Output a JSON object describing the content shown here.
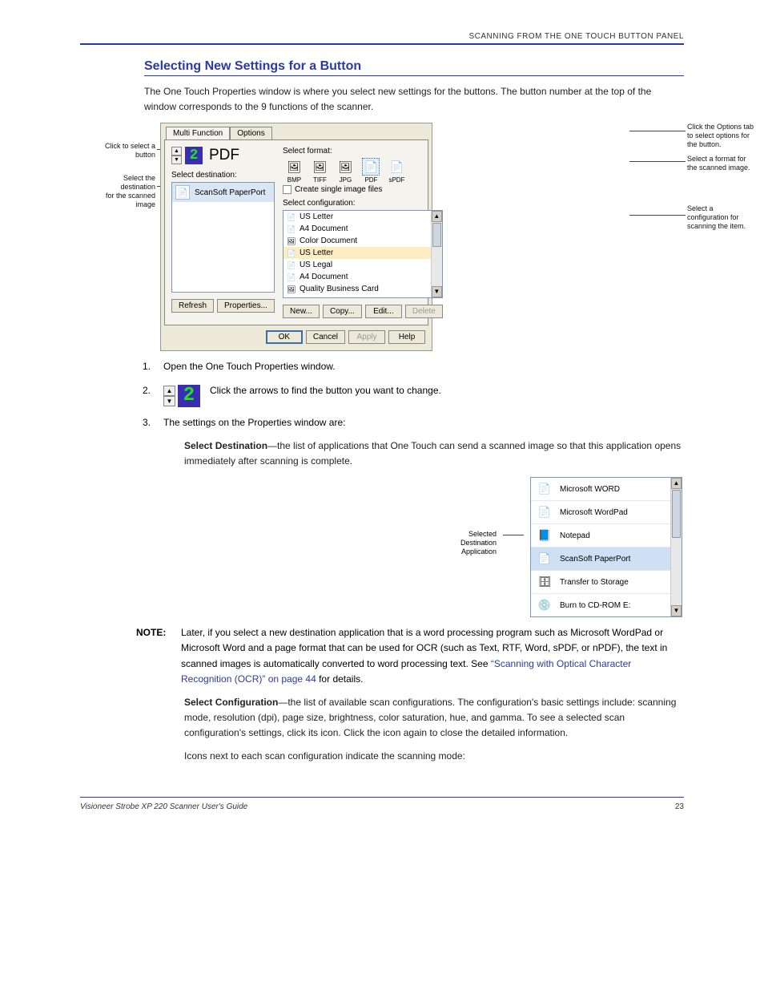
{
  "header": {
    "section_label": "SCANNING FROM THE ONE TOUCH BUTTON PANEL"
  },
  "section_heading": "Selecting New Settings for a Button",
  "intro": "The One Touch Properties window is where you select new settings for the buttons. The button number at the top of the window corresponds to the 9 functions of the scanner.",
  "dialog": {
    "tabs": {
      "active": "Multi Function",
      "inactive": "Options"
    },
    "top": {
      "digit": "2",
      "label": "PDF"
    },
    "left_label": "Select destination:",
    "dest_item": "ScanSoft PaperPort",
    "right_label1": "Select format:",
    "formats": [
      {
        "id": "bmp",
        "label": "BMP",
        "glyph": "🖼"
      },
      {
        "id": "tiff",
        "label": "TIFF",
        "glyph": "🖼"
      },
      {
        "id": "jpg",
        "label": "JPG",
        "glyph": "🖼"
      },
      {
        "id": "pdf",
        "label": "PDF",
        "glyph": "📄"
      },
      {
        "id": "spdf",
        "label": "sPDF",
        "glyph": "📄"
      }
    ],
    "format_selected_index": 3,
    "checkbox_label": "Create single image files",
    "right_label2": "Select configuration:",
    "configs": [
      {
        "name": "US Letter",
        "icon": "📄",
        "lock": true,
        "sel": false
      },
      {
        "name": "A4 Document",
        "icon": "📄",
        "lock": true,
        "sel": false
      },
      {
        "name": "Color Document",
        "icon": "🖼",
        "lock": true,
        "sel": false
      },
      {
        "name": "US Letter",
        "icon": "📄",
        "lock": true,
        "sel": true
      },
      {
        "name": "US Legal",
        "icon": "📄",
        "lock": true,
        "sel": false
      },
      {
        "name": "A4 Document",
        "icon": "📄",
        "lock": true,
        "sel": false
      },
      {
        "name": "Quality Business Card",
        "icon": "🖼",
        "lock": true,
        "sel": false
      }
    ],
    "btns_mid_left": {
      "refresh": "Refresh",
      "properties": "Properties..."
    },
    "btns_mid_right": {
      "new": "New...",
      "copy": "Copy...",
      "edit": "Edit...",
      "delete": "Delete"
    },
    "btns_bottom": {
      "ok": "OK",
      "cancel": "Cancel",
      "apply": "Apply",
      "help": "Help"
    }
  },
  "callouts": {
    "left1": "Click to select a",
    "left1b": "button",
    "left2": "Select the destination",
    "left2b": "for the scanned image",
    "right1": "Click the Options tab to select options for the button.",
    "right2": "Select a format for the scanned image.",
    "right3": "Select a configuration for scanning the item."
  },
  "step1": {
    "num": "1.",
    "text": "Open the One Touch Properties window."
  },
  "step2": {
    "num": "2.",
    "digit": "2",
    "text": "Click the arrows to find the button you want to change."
  },
  "step3": {
    "num": "3.",
    "text": "The settings on the Properties window are:"
  },
  "para_dest1_lead": "Select Destination",
  "para_dest1": "—the list of applications that One Touch can send a scanned image so that this application opens immediately after scanning is complete.",
  "note": {
    "label": "Note:",
    "text_a": "Later, if you select a new destination application that is a word processing program such as Microsoft WordPad or Microsoft Word and a page format that can be used for OCR (such as Text, RTF, Word, sPDF, or nPDF), the text in scanned images is automatically converted to word processing text. See ",
    "link": "“Scanning with Optical Character Recognition (OCR)” on page 44",
    "text_b": " for details."
  },
  "dest_float_callout": "Selected Destination Application",
  "dest_float": {
    "items": [
      {
        "name": "Microsoft WORD",
        "glyph": "📄",
        "color": "#3a6ea5"
      },
      {
        "name": "Microsoft WordPad",
        "glyph": "📄",
        "color": "#3a6ea5"
      },
      {
        "name": "Notepad",
        "glyph": "📘",
        "color": "#3a6ea5"
      },
      {
        "name": "ScanSoft PaperPort",
        "glyph": "📄",
        "color": "#3a6ea5",
        "sel": true
      },
      {
        "name": "Transfer to Storage",
        "glyph": "🗄",
        "color": "#c88a3b"
      },
      {
        "name": "Burn to CD-ROM  E:",
        "glyph": "💿",
        "color": "#888"
      }
    ]
  },
  "para_cfg_lead": "Select Configuration",
  "para_cfg": "—the list of available scan configurations. The configuration's basic settings include: scanning mode, resolution (dpi), page size, brightness, color saturation, hue, and gamma. To see a selected scan configuration's settings, click its icon. Click the icon again to close the detailed information.",
  "para_cfg2_a": "Icons next to each scan configuration indicate the scanning mode:",
  "footer": {
    "left": "Visioneer Strobe XP 220 Scanner User's Guide",
    "right": "23"
  }
}
